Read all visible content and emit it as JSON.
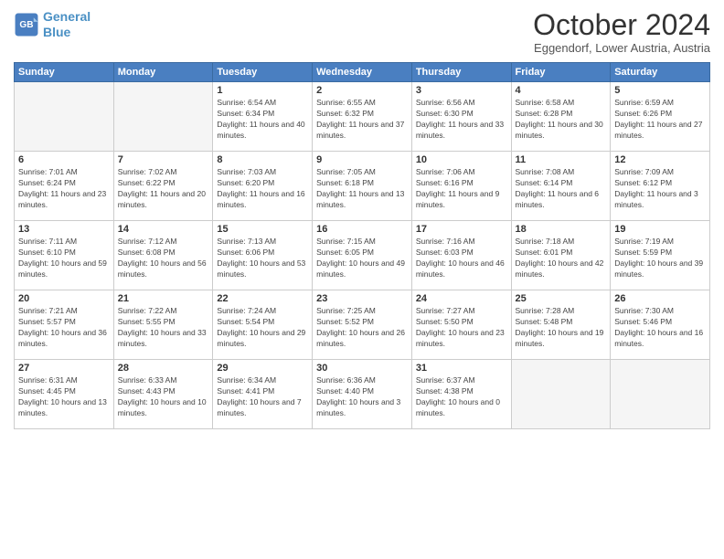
{
  "header": {
    "logo_line1": "General",
    "logo_line2": "Blue",
    "month": "October 2024",
    "location": "Eggendorf, Lower Austria, Austria"
  },
  "days_of_week": [
    "Sunday",
    "Monday",
    "Tuesday",
    "Wednesday",
    "Thursday",
    "Friday",
    "Saturday"
  ],
  "weeks": [
    [
      {
        "day": "",
        "info": ""
      },
      {
        "day": "",
        "info": ""
      },
      {
        "day": "1",
        "info": "Sunrise: 6:54 AM\nSunset: 6:34 PM\nDaylight: 11 hours and 40 minutes."
      },
      {
        "day": "2",
        "info": "Sunrise: 6:55 AM\nSunset: 6:32 PM\nDaylight: 11 hours and 37 minutes."
      },
      {
        "day": "3",
        "info": "Sunrise: 6:56 AM\nSunset: 6:30 PM\nDaylight: 11 hours and 33 minutes."
      },
      {
        "day": "4",
        "info": "Sunrise: 6:58 AM\nSunset: 6:28 PM\nDaylight: 11 hours and 30 minutes."
      },
      {
        "day": "5",
        "info": "Sunrise: 6:59 AM\nSunset: 6:26 PM\nDaylight: 11 hours and 27 minutes."
      }
    ],
    [
      {
        "day": "6",
        "info": "Sunrise: 7:01 AM\nSunset: 6:24 PM\nDaylight: 11 hours and 23 minutes."
      },
      {
        "day": "7",
        "info": "Sunrise: 7:02 AM\nSunset: 6:22 PM\nDaylight: 11 hours and 20 minutes."
      },
      {
        "day": "8",
        "info": "Sunrise: 7:03 AM\nSunset: 6:20 PM\nDaylight: 11 hours and 16 minutes."
      },
      {
        "day": "9",
        "info": "Sunrise: 7:05 AM\nSunset: 6:18 PM\nDaylight: 11 hours and 13 minutes."
      },
      {
        "day": "10",
        "info": "Sunrise: 7:06 AM\nSunset: 6:16 PM\nDaylight: 11 hours and 9 minutes."
      },
      {
        "day": "11",
        "info": "Sunrise: 7:08 AM\nSunset: 6:14 PM\nDaylight: 11 hours and 6 minutes."
      },
      {
        "day": "12",
        "info": "Sunrise: 7:09 AM\nSunset: 6:12 PM\nDaylight: 11 hours and 3 minutes."
      }
    ],
    [
      {
        "day": "13",
        "info": "Sunrise: 7:11 AM\nSunset: 6:10 PM\nDaylight: 10 hours and 59 minutes."
      },
      {
        "day": "14",
        "info": "Sunrise: 7:12 AM\nSunset: 6:08 PM\nDaylight: 10 hours and 56 minutes."
      },
      {
        "day": "15",
        "info": "Sunrise: 7:13 AM\nSunset: 6:06 PM\nDaylight: 10 hours and 53 minutes."
      },
      {
        "day": "16",
        "info": "Sunrise: 7:15 AM\nSunset: 6:05 PM\nDaylight: 10 hours and 49 minutes."
      },
      {
        "day": "17",
        "info": "Sunrise: 7:16 AM\nSunset: 6:03 PM\nDaylight: 10 hours and 46 minutes."
      },
      {
        "day": "18",
        "info": "Sunrise: 7:18 AM\nSunset: 6:01 PM\nDaylight: 10 hours and 42 minutes."
      },
      {
        "day": "19",
        "info": "Sunrise: 7:19 AM\nSunset: 5:59 PM\nDaylight: 10 hours and 39 minutes."
      }
    ],
    [
      {
        "day": "20",
        "info": "Sunrise: 7:21 AM\nSunset: 5:57 PM\nDaylight: 10 hours and 36 minutes."
      },
      {
        "day": "21",
        "info": "Sunrise: 7:22 AM\nSunset: 5:55 PM\nDaylight: 10 hours and 33 minutes."
      },
      {
        "day": "22",
        "info": "Sunrise: 7:24 AM\nSunset: 5:54 PM\nDaylight: 10 hours and 29 minutes."
      },
      {
        "day": "23",
        "info": "Sunrise: 7:25 AM\nSunset: 5:52 PM\nDaylight: 10 hours and 26 minutes."
      },
      {
        "day": "24",
        "info": "Sunrise: 7:27 AM\nSunset: 5:50 PM\nDaylight: 10 hours and 23 minutes."
      },
      {
        "day": "25",
        "info": "Sunrise: 7:28 AM\nSunset: 5:48 PM\nDaylight: 10 hours and 19 minutes."
      },
      {
        "day": "26",
        "info": "Sunrise: 7:30 AM\nSunset: 5:46 PM\nDaylight: 10 hours and 16 minutes."
      }
    ],
    [
      {
        "day": "27",
        "info": "Sunrise: 6:31 AM\nSunset: 4:45 PM\nDaylight: 10 hours and 13 minutes."
      },
      {
        "day": "28",
        "info": "Sunrise: 6:33 AM\nSunset: 4:43 PM\nDaylight: 10 hours and 10 minutes."
      },
      {
        "day": "29",
        "info": "Sunrise: 6:34 AM\nSunset: 4:41 PM\nDaylight: 10 hours and 7 minutes."
      },
      {
        "day": "30",
        "info": "Sunrise: 6:36 AM\nSunset: 4:40 PM\nDaylight: 10 hours and 3 minutes."
      },
      {
        "day": "31",
        "info": "Sunrise: 6:37 AM\nSunset: 4:38 PM\nDaylight: 10 hours and 0 minutes."
      },
      {
        "day": "",
        "info": ""
      },
      {
        "day": "",
        "info": ""
      }
    ]
  ]
}
